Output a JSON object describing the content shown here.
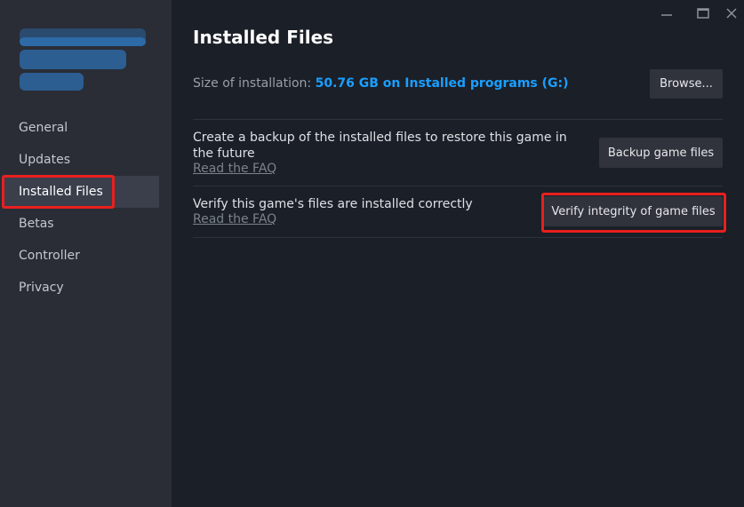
{
  "sidebar": {
    "logo": "blurred-game-logo",
    "items": [
      {
        "label": "General",
        "active": false
      },
      {
        "label": "Updates",
        "active": false
      },
      {
        "label": "Installed Files",
        "active": true
      },
      {
        "label": "Betas",
        "active": false
      },
      {
        "label": "Controller",
        "active": false
      },
      {
        "label": "Privacy",
        "active": false
      }
    ]
  },
  "window_controls": {
    "minimize": "minimize-icon",
    "maximize": "maximize-icon",
    "close": "close-icon"
  },
  "main": {
    "title": "Installed Files",
    "size_label": "Size of installation:",
    "size_value": "50.76 GB on Installed programs (G:)",
    "browse_label": "Browse...",
    "sections": [
      {
        "description": "Create a backup of the installed files to restore this game in the future",
        "faq_label": "Read the FAQ",
        "button_label": "Backup game files"
      },
      {
        "description": "Verify this game's files are installed correctly",
        "faq_label": "Read the FAQ",
        "button_label": "Verify integrity of game files"
      }
    ]
  },
  "colors": {
    "accent": "#1a9fff",
    "highlight_box": "#e8201f",
    "sidebar_bg": "#2a2d36",
    "main_bg": "#1b1f27"
  }
}
